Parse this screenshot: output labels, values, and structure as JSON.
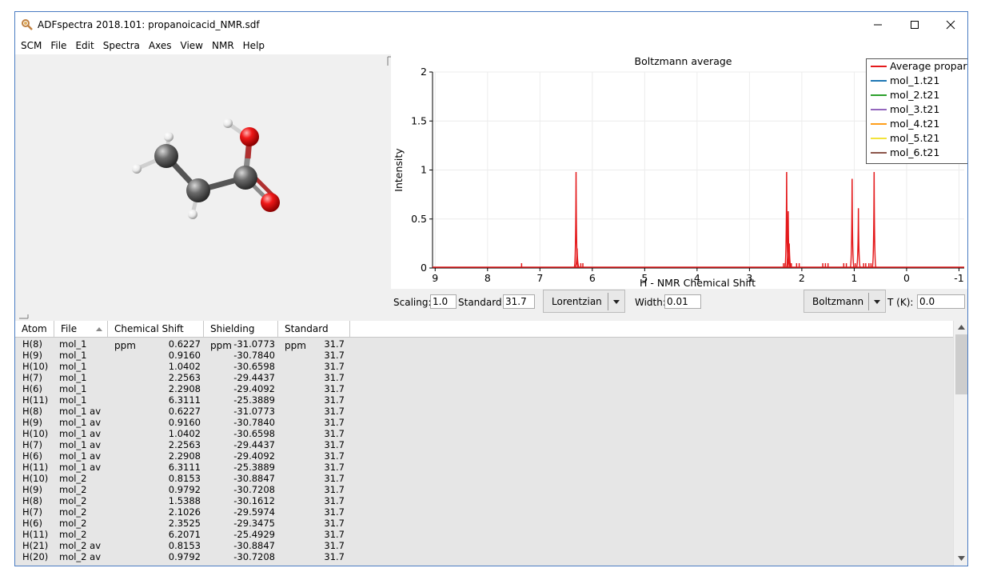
{
  "window": {
    "title": "ADFspectra 2018.101: propanoicacid_NMR.sdf"
  },
  "menu": [
    "SCM",
    "File",
    "Edit",
    "Spectra",
    "Axes",
    "View",
    "NMR",
    "Help"
  ],
  "chart_data": {
    "type": "line",
    "title": "Boltzmann average",
    "xlabel": "H - NMR Chemical Shift",
    "ylabel": "Intensity",
    "xlim": [
      9.05,
      -1.1
    ],
    "ylim": [
      0,
      2
    ],
    "xticks": [
      "9",
      "8",
      "7",
      "6",
      "5",
      "4",
      "3",
      "2",
      "1",
      "0",
      "-1"
    ],
    "yticks": [
      "0",
      "0.5",
      "1",
      "1.5",
      "2"
    ],
    "legend_position": "top-right",
    "legend": [
      {
        "label": "Average propar",
        "color": "#e41a1c"
      },
      {
        "label": "mol_1.t21",
        "color": "#1f77b4"
      },
      {
        "label": "mol_2.t21",
        "color": "#2ca02c"
      },
      {
        "label": "mol_3.t21",
        "color": "#9467bd"
      },
      {
        "label": "mol_4.t21",
        "color": "#ff9f1c"
      },
      {
        "label": "mol_5.t21",
        "color": "#f2e33b"
      },
      {
        "label": "mol_6.t21",
        "color": "#8c564b"
      }
    ],
    "peaks": [
      {
        "x": 6.31,
        "y": 0.98
      },
      {
        "x": 6.29,
        "y": 0.2
      },
      {
        "x": 2.29,
        "y": 0.98
      },
      {
        "x": 2.26,
        "y": 0.58
      },
      {
        "x": 2.24,
        "y": 0.25
      },
      {
        "x": 1.04,
        "y": 0.91
      },
      {
        "x": 0.92,
        "y": 0.61
      },
      {
        "x": 0.62,
        "y": 0.98
      }
    ],
    "stick_marks": [
      7.35,
      6.22,
      6.18,
      2.35,
      2.32,
      2.2,
      2.1,
      2.05,
      1.6,
      1.55,
      1.5,
      1.2,
      1.15,
      0.98,
      0.82,
      0.78,
      0.72,
      0.68
    ]
  },
  "controls": {
    "scaling_label": "Scaling:",
    "scaling_value": "1.0",
    "standard_label": "Standard:",
    "standard_value": "31.7",
    "lineshape": "Lorentzian",
    "width_label": "Width:",
    "width_value": "0.01",
    "weighting": "Boltzmann",
    "temp_label": "T (K):",
    "temp_value": "0.0"
  },
  "table": {
    "columns": [
      "Atom",
      "File",
      "Chemical Shift ppm",
      "Shielding ppm",
      "Standard ppm"
    ],
    "rows": [
      [
        "H(8)",
        "mol_1",
        "0.6227",
        "-31.0773",
        "31.7"
      ],
      [
        "H(9)",
        "mol_1",
        "0.9160",
        "-30.7840",
        "31.7"
      ],
      [
        "H(10)",
        "mol_1",
        "1.0402",
        "-30.6598",
        "31.7"
      ],
      [
        "H(7)",
        "mol_1",
        "2.2563",
        "-29.4437",
        "31.7"
      ],
      [
        "H(6)",
        "mol_1",
        "2.2908",
        "-29.4092",
        "31.7"
      ],
      [
        "H(11)",
        "mol_1",
        "6.3111",
        "-25.3889",
        "31.7"
      ],
      [
        "H(8)",
        "mol_1 av",
        "0.6227",
        "-31.0773",
        "31.7"
      ],
      [
        "H(9)",
        "mol_1 av",
        "0.9160",
        "-30.7840",
        "31.7"
      ],
      [
        "H(10)",
        "mol_1 av",
        "1.0402",
        "-30.6598",
        "31.7"
      ],
      [
        "H(7)",
        "mol_1 av",
        "2.2563",
        "-29.4437",
        "31.7"
      ],
      [
        "H(6)",
        "mol_1 av",
        "2.2908",
        "-29.4092",
        "31.7"
      ],
      [
        "H(11)",
        "mol_1 av",
        "6.3111",
        "-25.3889",
        "31.7"
      ],
      [
        "H(10)",
        "mol_2",
        "0.8153",
        "-30.8847",
        "31.7"
      ],
      [
        "H(9)",
        "mol_2",
        "0.9792",
        "-30.7208",
        "31.7"
      ],
      [
        "H(8)",
        "mol_2",
        "1.5388",
        "-30.1612",
        "31.7"
      ],
      [
        "H(7)",
        "mol_2",
        "2.1026",
        "-29.5974",
        "31.7"
      ],
      [
        "H(6)",
        "mol_2",
        "2.3525",
        "-29.3475",
        "31.7"
      ],
      [
        "H(11)",
        "mol_2",
        "6.2071",
        "-25.4929",
        "31.7"
      ],
      [
        "H(21)",
        "mol_2 av",
        "0.8153",
        "-30.8847",
        "31.7"
      ],
      [
        "H(20)",
        "mol_2 av",
        "0.9792",
        "-30.7208",
        "31.7"
      ]
    ]
  },
  "colors": {
    "spectrum": "#e41a1c",
    "oxygen": "#e8101c",
    "carbon": "#555555",
    "hydrogen": "#f2f2f2",
    "bond": "#b03030"
  }
}
